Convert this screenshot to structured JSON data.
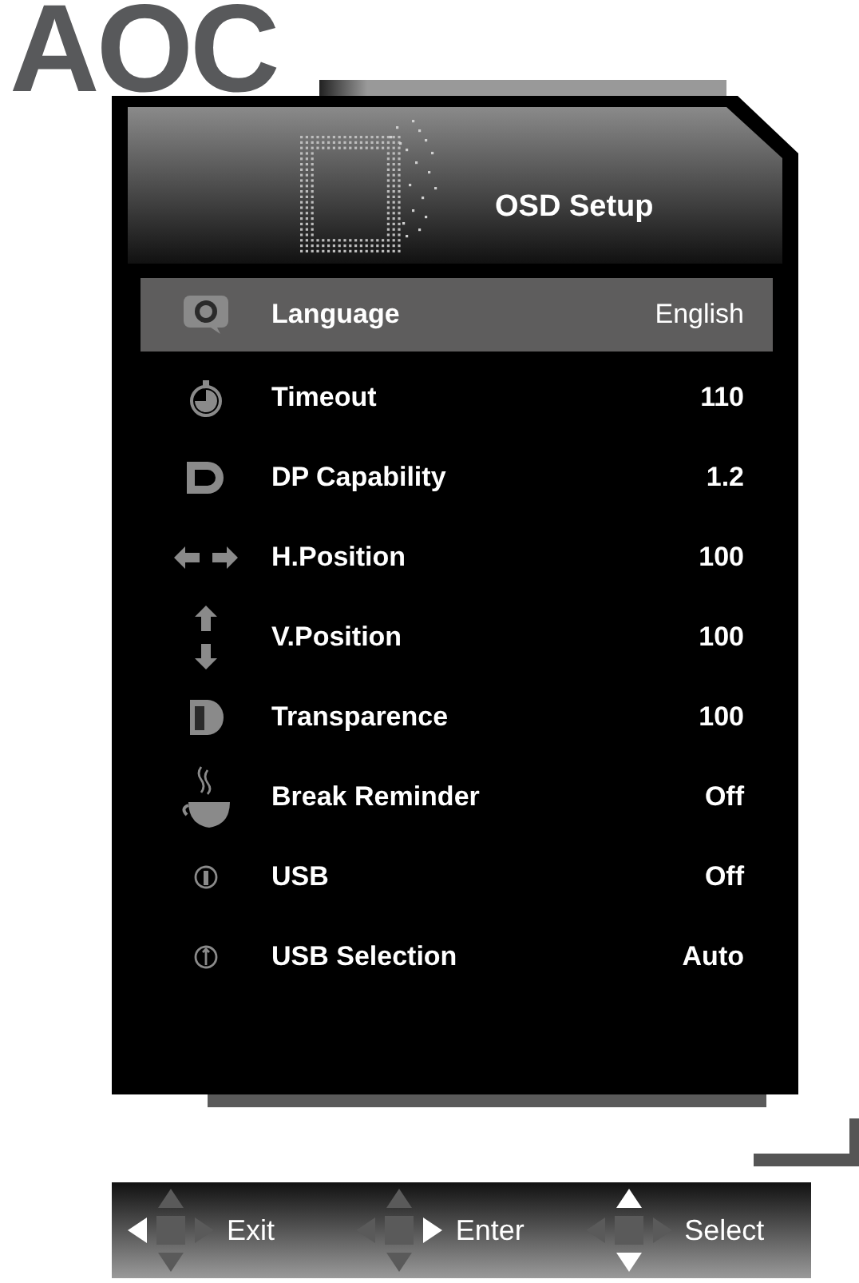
{
  "logo": "AOC",
  "menu": {
    "title": "OSD Setup",
    "items": [
      {
        "kind": "language",
        "label": "Language",
        "value": "English",
        "selected": true
      },
      {
        "kind": "timer",
        "label": "Timeout",
        "value": "110",
        "selected": false
      },
      {
        "kind": "dp",
        "label": "DP Capability",
        "value": "1.2",
        "selected": false
      },
      {
        "kind": "hpos",
        "label": "H.Position",
        "value": "100",
        "selected": false
      },
      {
        "kind": "vpos",
        "label": "V.Position",
        "value": "100",
        "selected": false
      },
      {
        "kind": "transparence",
        "label": "Transparence",
        "value": "100",
        "selected": false
      },
      {
        "kind": "break",
        "label": "Break Reminder",
        "value": "Off",
        "selected": false
      },
      {
        "kind": "usb",
        "label": "USB",
        "value": "Off",
        "selected": false
      },
      {
        "kind": "usbsel",
        "label": "USB Selection",
        "value": "Auto",
        "selected": false
      }
    ]
  },
  "key_hints": [
    {
      "kind": "left",
      "label": "Exit"
    },
    {
      "kind": "right",
      "label": "Enter"
    },
    {
      "kind": "updown",
      "label": "Select"
    }
  ]
}
